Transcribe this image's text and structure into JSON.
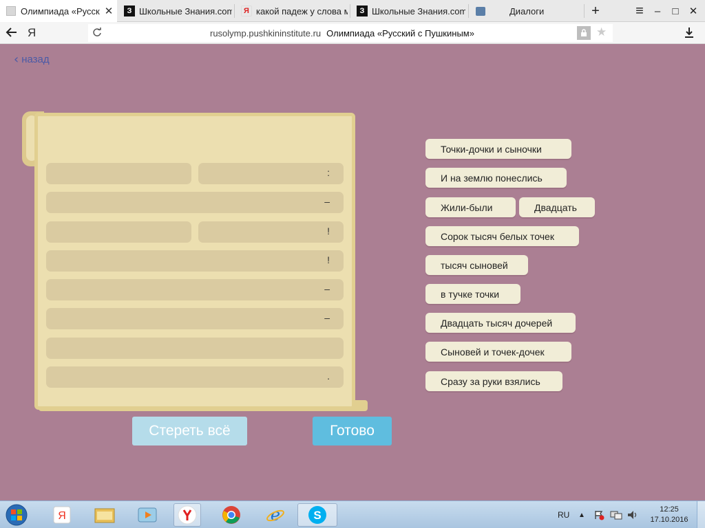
{
  "browser": {
    "tabs": [
      {
        "title": "Олимпиада «Русск",
        "favicon": "page-icon"
      },
      {
        "title": "Школьные Знания.com",
        "favicon": "znanija-icon",
        "favicon_glyph": "З"
      },
      {
        "title": "какой падеж у слова м",
        "favicon": "yandex-icon",
        "favicon_glyph": "Я"
      },
      {
        "title": "Школьные Знания.com",
        "favicon": "znanija-icon",
        "favicon_glyph": "З"
      },
      {
        "title": "Диалоги",
        "favicon": "vk-dialog-icon"
      }
    ],
    "close_glyph": "✕",
    "new_tab_glyph": "+",
    "menu_glyph": "≡",
    "minimize_glyph": "–",
    "maximize_glyph": "□",
    "close_window_glyph": "✕",
    "address_host": "rusolymp.pushkininstitute.ru",
    "address_title": "Олимпиада «Русский с Пушкиным»",
    "yandex_glyph": "Я"
  },
  "page": {
    "back_label": "назад",
    "slots_punctuation": [
      ":",
      "–",
      "!",
      "!",
      "–",
      "–",
      "",
      "."
    ],
    "phrases": [
      "Точки-дочки и сыночки",
      "И на землю понеслись",
      "Жили-были",
      "Двадцать",
      "Сорок тысяч белых точек",
      "тысяч сыновей",
      "в тучке точки",
      "Двадцать тысяч дочерей",
      "Сыновей и точек-дочек",
      "Сразу за руки взялись"
    ],
    "clear_button": "Стереть всё",
    "done_button": "Готово"
  },
  "taskbar": {
    "apps": [
      "start-orb-icon",
      "yandex-icon",
      "explorer-icon",
      "media-player-icon",
      "yandex-browser-icon",
      "chrome-icon",
      "ie-icon",
      "skype-icon"
    ],
    "lang": "RU",
    "time": "12:25",
    "date": "17.10.2016"
  },
  "colors": {
    "background": "#ab7f93",
    "parchment": "#ecdfb0",
    "slot": "#dacba1",
    "chip": "#f1edd7",
    "done_button": "#5fbddf",
    "clear_button": "#b5dcea",
    "link": "#4a5aa7"
  }
}
